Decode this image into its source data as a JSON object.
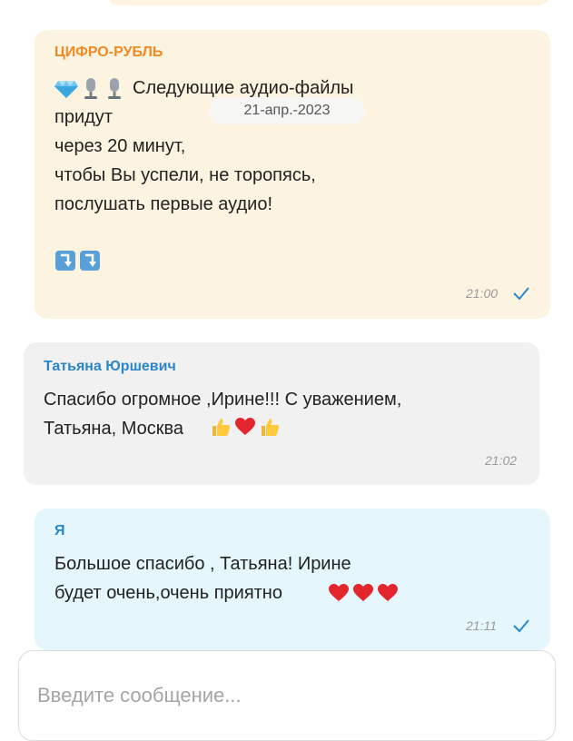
{
  "messages": {
    "channel": {
      "sender": "ЦИФРО-РУБЛЬ",
      "line1": "Следующие аудио-файлы",
      "body": "придут\nчерез 20 минут,\nчтобы Вы успели, не торопясь,\nпослушать первые аудио!",
      "time": "21:00",
      "icons": [
        "gem-icon",
        "microphone-icon",
        "microphone-icon",
        "arrow-down-icon",
        "arrow-down-icon"
      ]
    },
    "incoming": {
      "sender": "Татьяна Юршевич",
      "body": "Спасибо огромное ,Ирине!!! С уважением,\nТатьяна, Москва",
      "time": "21:02",
      "icons": [
        "thumbs-up-icon",
        "heart-icon",
        "thumbs-up-icon"
      ]
    },
    "own": {
      "sender": "Я",
      "line1": "Большое спасибо , Татьяна! Ирине",
      "line2": "будет очень,очень приятно",
      "time": "21:11",
      "icons": [
        "heart-icon",
        "heart-icon",
        "heart-icon"
      ]
    }
  },
  "date_chip": "21-апр.-2023",
  "composer": {
    "placeholder": "Введите сообщение..."
  },
  "colors": {
    "channel_bg": "#fdf3e1",
    "incoming_bg": "#f1f1f1",
    "own_bg": "#e5f6fd",
    "check": "#2b86c9"
  }
}
